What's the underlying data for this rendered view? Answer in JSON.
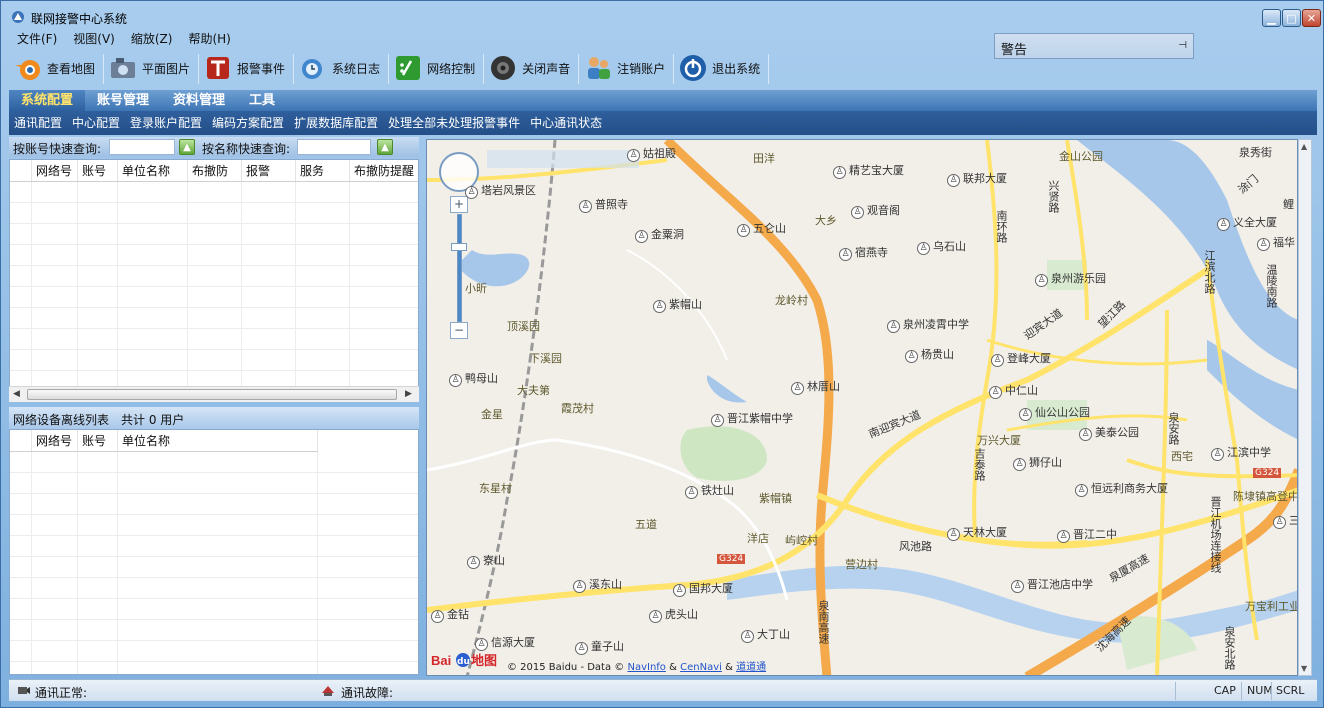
{
  "window": {
    "title": "联网接警中心系统"
  },
  "menu": [
    "文件(F)",
    "视图(V)",
    "缩放(Z)",
    "帮助(H)"
  ],
  "toolbar": [
    {
      "label": "查看地图",
      "icon": "blender-icon"
    },
    {
      "label": "平面图片",
      "icon": "camera-icon"
    },
    {
      "label": "报警事件",
      "icon": "alarm-icon"
    },
    {
      "label": "系统日志",
      "icon": "log-icon"
    },
    {
      "label": "网络控制",
      "icon": "network-icon"
    },
    {
      "label": "关闭声音",
      "icon": "speaker-icon"
    },
    {
      "label": "注销账户",
      "icon": "users-icon"
    },
    {
      "label": "退出系统",
      "icon": "power-icon"
    }
  ],
  "alert": {
    "label": "警告"
  },
  "tabs": [
    "系统配置",
    "账号管理",
    "资料管理",
    "工具"
  ],
  "subnav": [
    "通讯配置",
    "中心配置",
    "登录账户配置",
    "编码方案配置",
    "扩展数据库配置",
    "处理全部未处理报警事件",
    "中心通讯状态"
  ],
  "query": {
    "by_account": "按账号快速查询:",
    "by_name": "按名称快速查询:"
  },
  "table1": {
    "headers": [
      "网络号",
      "账号",
      "单位名称",
      "布撤防",
      "报警",
      "服务",
      "布撤防提醒"
    ]
  },
  "offline": {
    "title": "网络设备离线列表",
    "count": "共计 0 用户"
  },
  "table2": {
    "headers": [
      "网络号",
      "账号",
      "单位名称"
    ]
  },
  "map": {
    "places": {
      "p1": "姑祖殿",
      "p2": "田洋",
      "p3": "精艺宝大厦",
      "p4": "联邦大厦",
      "p5": "金山公园",
      "p6": "普照寺",
      "p7": "金粟洞",
      "p8": "五仑山",
      "p9": "大乡",
      "p10": "观音阁",
      "p11": "宿燕寺",
      "p12": "乌石山",
      "p13": "泉州游乐园",
      "p14": "紫帽山",
      "p15": "龙岭村",
      "p16": "泉州凌霄中学",
      "p17": "顶溪园",
      "p18": "下溪园",
      "p19": "杨贵山",
      "p20": "登峰大厦",
      "p21": "鸭母山",
      "p22": "大夫第",
      "p23": "霞茂村",
      "p24": "林厝山",
      "p25": "中仁山",
      "p26": "金星",
      "p27": "晋江紫帽中学",
      "p28": "仙公山公园",
      "p29": "万兴大厦",
      "p30": "美泰公园",
      "p31": "狮仔山",
      "p32": "江滨中学",
      "p33": "东星村",
      "p34": "铁灶山",
      "p35": "紫帽镇",
      "p36": "恒远利商务大厦",
      "p37": "陈埭镇高登中",
      "p38": "五道",
      "p39": "洋店",
      "p40": "屿崆村",
      "p41": "天林大厦",
      "p42": "晋江二中",
      "p43": "寮山",
      "p44": "营边村",
      "p45": "溪东山",
      "p46": "国邦大厦",
      "p47": "晋江池店中学",
      "p48": "金钻",
      "p49": "虎头山",
      "p50": "信源大厦",
      "p51": "大丁山",
      "p52": "童子山",
      "p53": "万宝利工业",
      "p54": "义全大厦",
      "p55": "福华",
      "p56": "塔岩风景区",
      "p57": "西宅",
      "p58": "小昕",
      "p59": "三"
    },
    "roads": {
      "r1": "南环路",
      "r2": "兴贤路",
      "r3": "迎宾大道",
      "r4": "望江路",
      "r5": "南迎宾大道",
      "r6": "吉泰路",
      "r7": "风池路",
      "r8": "泉安路",
      "r9": "泉南高速",
      "r10": "泉厦高速",
      "r11": "晋江机场连接线",
      "r12": "江滨北路",
      "r13": "G324",
      "r14": "G324",
      "r15": "泉安北路",
      "r16": "沈海高速",
      "r17": "温陵南路",
      "r18": "涂门",
      "r19": "鲤",
      "r20": "泉秀街"
    },
    "attribution": {
      "logo": "Bai地图",
      "text": "© 2015 Baidu - Data ©",
      "l1": "NavInfo",
      "amp": "&",
      "l2": "CenNavi",
      "l3": "道道通"
    }
  },
  "status": {
    "ok": "通讯正常:",
    "fault": "通讯故障:",
    "cap": "CAP",
    "num": "NUM",
    "scrl": "SCRL"
  },
  "colors": {
    "tab_active": "#ffe36a",
    "submenu_bg": "#244f88",
    "road_major": "#f4a94b",
    "road_minor": "#ffe36a",
    "water": "#a6c7ea"
  }
}
